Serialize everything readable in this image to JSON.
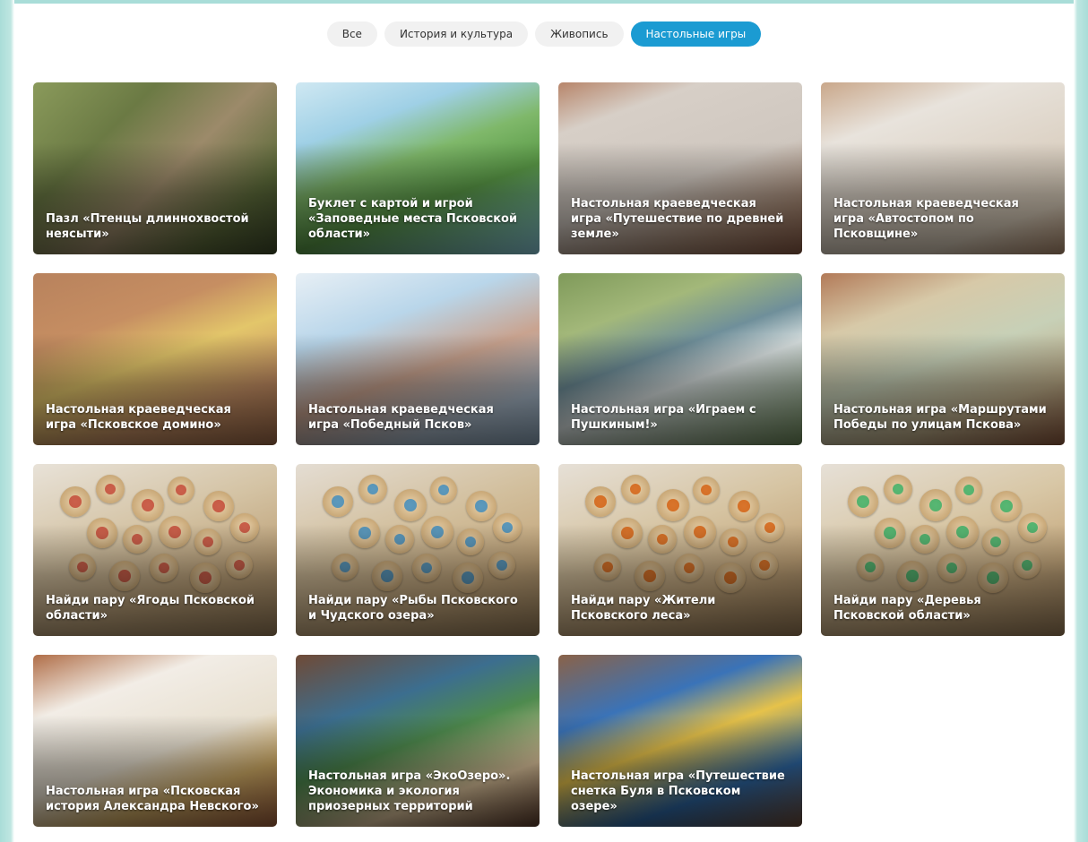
{
  "tabs": [
    {
      "label": "Все",
      "active": false
    },
    {
      "label": "История и культура",
      "active": false
    },
    {
      "label": "Живопись",
      "active": false
    },
    {
      "label": "Настольные игры",
      "active": true
    }
  ],
  "cards": [
    {
      "title": "Пазл «Птенцы длиннохвостой неясыти»",
      "bg": "linear-gradient(135deg,#8a9a5b 0%,#6b7a44 30%,#9c8a6a 55%,#5d6b3a 80%,#3e4a2a 100%)"
    },
    {
      "title": "Буклет с картой и игрой «Заповедные места Псковской области»",
      "bg": "linear-gradient(160deg,#cfe8f2 0%,#9fd0e6 25%,#7fb86a 45%,#5a9a47 65%,#8ccfe0 100%)"
    },
    {
      "title": "Настольная краеведческая игра «Путешествие по древней земле»",
      "bg": "linear-gradient(160deg,#b7856a 0%,#d7cfc7 20%,#cfc7bf 55%,#a98b76 80%,#8a5a44 100%)"
    },
    {
      "title": "Настольная краеведческая игра «Автостопом по Псковщине»",
      "bg": "linear-gradient(160deg,#c9a78a 0%,#e8e3dc 25%,#ddd3c6 55%,#d8cbb8 80%,#b28e70 100%)"
    },
    {
      "title": "Настольная краеведческая игра «Псковское домино»",
      "bg": "linear-gradient(160deg,#b8825d 0%,#c68e62 30%,#e3c66a 50%,#c89165 75%,#9e6a48 100%)"
    },
    {
      "title": "Настольная краеведческая игра «Победный Псков»",
      "bg": "linear-gradient(160deg,#e7eff5 0%,#b9d6ea 30%,#c9a38f 55%,#a7b7c7 80%,#8aa3b8 100%)"
    },
    {
      "title": "Настольная игра «Играем с Пушкиным!»",
      "bg": "linear-gradient(160deg,#7f9a5a 0%,#a3b87a 25%,#6f8f9a 45%,#d8e0e0 60%,#6d8a5a 100%)"
    },
    {
      "title": "Настольная игра «Маршрутами Победы по улицам Пскова»",
      "bg": "linear-gradient(160deg,#b27a58 0%,#d7c9a8 25%,#c7d0b7 50%,#bfae8a 75%,#8f5a3e 100%)"
    },
    {
      "title": "Найди пару «Ягоды Псковской области»",
      "bg": "linear-gradient(160deg,#e8e2d8 0%,#d4c3a4 40%,#bfa37a 70%,#9a7f5a 100%)"
    },
    {
      "title": "Найди пару «Рыбы Псковского и Чудского озера»",
      "bg": "linear-gradient(160deg,#e4ddd3 0%,#d2bf9d 40%,#c4a77c 70%,#9a7f5a 100%)"
    },
    {
      "title": "Найди пару «Жители Псковского леса»",
      "bg": "linear-gradient(160deg,#e6e0d7 0%,#d6c4a2 40%,#c3a57a 70%,#977a55 100%)"
    },
    {
      "title": "Найди пару «Деревья Псковской области»",
      "bg": "linear-gradient(160deg,#e6e0d7 0%,#d8c7a6 40%,#c6a97e 70%,#9a7d58 100%)"
    },
    {
      "title": "Настольная игра «Псковская история Александра Невского»",
      "bg": "linear-gradient(160deg,#b06e48 0%,#f2ede6 25%,#e8e0d0 55%,#d9b36a 75%,#a05f3c 100%)"
    },
    {
      "title": "Настольная игра «ЭкоОзеро». Экономика и экология приозерных территорий",
      "bg": "linear-gradient(160deg,#6f4a36 0%,#3c6e8f 30%,#4e8a4e 50%,#e3c9a0 75%,#5a3a2a 100%)"
    },
    {
      "title": "Настольная игра «Путешествие снетка Буля в Псковском озере»",
      "bg": "linear-gradient(160deg,#8a6248 0%,#3a73b8 30%,#e6c24a 50%,#2f6aa8 75%,#6b4a36 100%)"
    }
  ]
}
